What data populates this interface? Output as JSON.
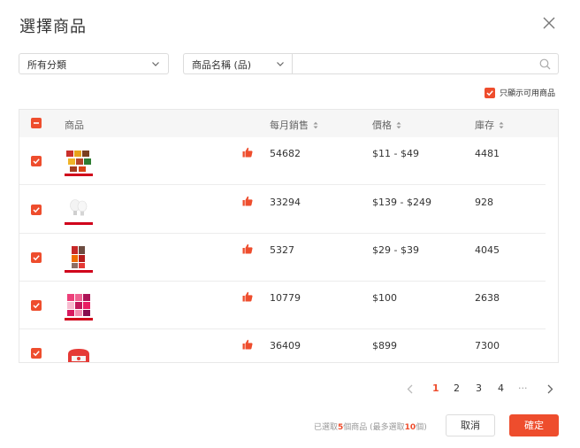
{
  "dialog": {
    "title": "選擇商品"
  },
  "filters": {
    "category": "所有分類",
    "field": "商品名稱 (品)",
    "search_value": "",
    "only_available_label": "只顯示可用商品"
  },
  "table": {
    "columns": {
      "product": "商品",
      "sales": "每月銷售",
      "price": "價格",
      "stock": "庫存"
    },
    "rows": [
      {
        "sales": "54682",
        "price": "$11 - $49",
        "stock": "4481"
      },
      {
        "sales": "33294",
        "price": "$139 - $249",
        "stock": "928"
      },
      {
        "sales": "5327",
        "price": "$29 - $39",
        "stock": "4045"
      },
      {
        "sales": "10779",
        "price": "$100",
        "stock": "2638"
      },
      {
        "sales": "36409",
        "price": "$899",
        "stock": "7300"
      }
    ]
  },
  "pagination": {
    "pages": [
      "1",
      "2",
      "3",
      "4"
    ],
    "current": "1",
    "ellipsis": "···"
  },
  "footer": {
    "note_prefix": "已選取",
    "selected_count": "5",
    "note_middle": "個商品 (最多選取",
    "max_count": "10",
    "note_suffix": "個)",
    "cancel_label": "取消",
    "confirm_label": "確定"
  },
  "colors": {
    "accent": "#ee4d2d"
  },
  "icons": {
    "close": "close-icon",
    "dropdown": "chevron-down-icon",
    "search": "search-icon",
    "like": "thumbs-up-icon",
    "sort": "sort-icon",
    "prev": "chevron-left-icon",
    "next": "chevron-right-icon"
  }
}
